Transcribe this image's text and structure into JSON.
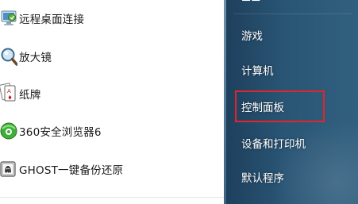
{
  "programs": [
    {
      "label": "远程桌面连接",
      "icon": "remote-desktop-icon"
    },
    {
      "label": "放大镜",
      "icon": "magnifier-icon"
    },
    {
      "label": "纸牌",
      "icon": "solitaire-icon"
    },
    {
      "label": "360安全浏览器6",
      "icon": "browser-360-icon"
    },
    {
      "label": "GHOST一键备份还原",
      "icon": "ghost-backup-icon"
    }
  ],
  "places": [
    {
      "label": "游戏"
    },
    {
      "label": "计算机"
    },
    {
      "label": "控制面板",
      "highlighted": true
    },
    {
      "label": "设备和打印机"
    },
    {
      "label": "默认程序"
    }
  ],
  "colors": {
    "highlight": "#e0262b",
    "right_pane": "#2a5575"
  }
}
